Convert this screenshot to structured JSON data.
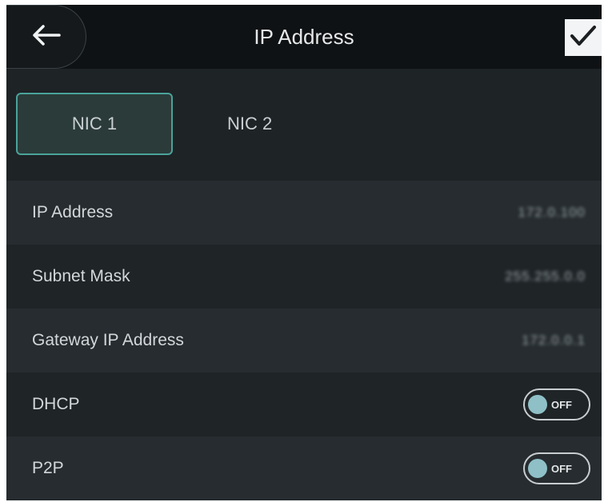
{
  "header": {
    "title": "IP Address",
    "back_icon": "arrow-left-icon",
    "confirm_icon": "check-icon"
  },
  "tabs": [
    {
      "label": "NIC 1",
      "active": true
    },
    {
      "label": "NIC 2",
      "active": false
    }
  ],
  "rows": {
    "ip_address": {
      "label": "IP Address",
      "value": "172.0.100"
    },
    "subnet_mask": {
      "label": "Subnet Mask",
      "value": "255.255.0.0"
    },
    "gateway": {
      "label": "Gateway IP Address",
      "value": "172.0.0.1"
    },
    "dhcp": {
      "label": "DHCP",
      "state": "OFF"
    },
    "p2p": {
      "label": "P2P",
      "state": "OFF"
    }
  },
  "colors": {
    "accent": "#4aa39a",
    "toggle_knob": "#8fc0c7",
    "background": "#1e2326"
  }
}
